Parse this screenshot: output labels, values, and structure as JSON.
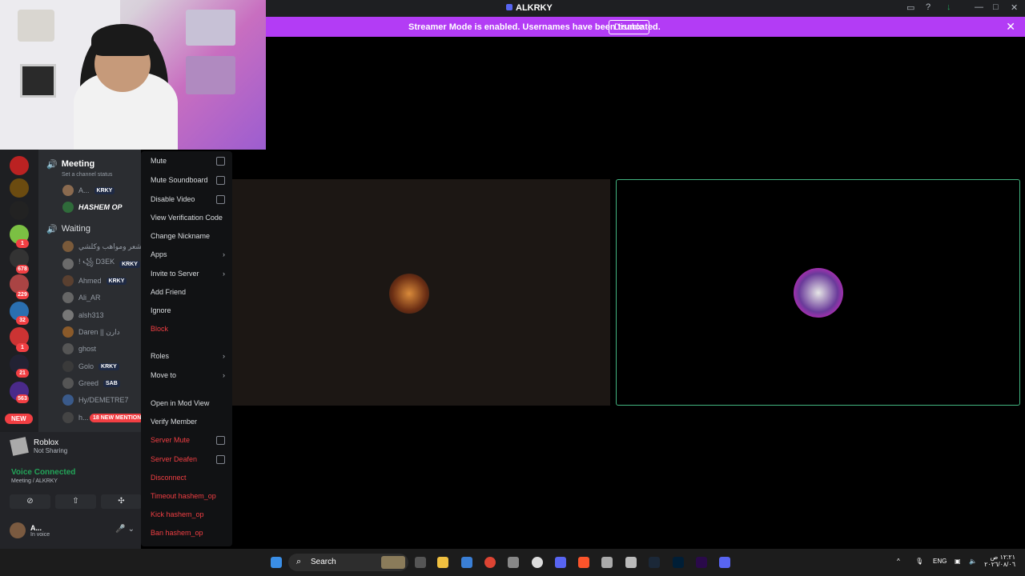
{
  "window": {
    "title": "ALKRKY"
  },
  "banner": {
    "text": "Streamer Mode is enabled. Usernames have been truncated.",
    "button": "Disable",
    "color": "#b33cf5"
  },
  "guilds": {
    "badges": [
      "1",
      "678",
      "229",
      "32",
      "1",
      "21",
      "563"
    ],
    "new_label": "NEW"
  },
  "channels": {
    "active_channel": "Meeting",
    "status_hint": "Set a channel status",
    "waiting_channel": "Waiting",
    "members_meeting": [
      {
        "name": "A...",
        "tag": "KRKY"
      },
      {
        "name": "HASHEM OP",
        "tag": ""
      }
    ],
    "members_waiting": [
      {
        "name": "و شعر ومواهب وكلشي |",
        "tag": ""
      },
      {
        "name": "! ꧁ D3EK",
        "tag": "KRKY"
      },
      {
        "name": "Ahmed",
        "tag": "KRKY"
      },
      {
        "name": "Ali_AR",
        "tag": ""
      },
      {
        "name": "alsh313",
        "tag": ""
      },
      {
        "name": "Daren || دارن",
        "tag": ""
      },
      {
        "name": "ghost",
        "tag": ""
      },
      {
        "name": "Golo",
        "tag": "KRKY"
      },
      {
        "name": "Greed",
        "tag": "SAB"
      },
      {
        "name": "Hy/DEMETRE7",
        "tag": ""
      },
      {
        "name": "h...",
        "tag": ""
      }
    ],
    "mentions_pill": "18 NEW MENTION"
  },
  "bottom": {
    "game_name": "Roblox",
    "game_status": "Not Sharing",
    "voice_title": "Voice Connected",
    "voice_sub": "Meeting / ALKRKY",
    "user_name": "A...",
    "user_status": "In voice"
  },
  "context_menu": [
    {
      "label": "Mute",
      "kind": "checkbox",
      "danger": false
    },
    {
      "label": "Mute Soundboard",
      "kind": "checkbox",
      "danger": false
    },
    {
      "label": "Disable Video",
      "kind": "checkbox",
      "danger": false
    },
    {
      "label": "View Verification Code",
      "kind": "plain",
      "danger": false
    },
    {
      "label": "Change Nickname",
      "kind": "plain",
      "danger": false
    },
    {
      "label": "Apps",
      "kind": "submenu",
      "danger": false
    },
    {
      "label": "Invite to Server",
      "kind": "submenu",
      "danger": false
    },
    {
      "label": "Add Friend",
      "kind": "plain",
      "danger": false
    },
    {
      "label": "Ignore",
      "kind": "plain",
      "danger": false
    },
    {
      "label": "Block",
      "kind": "plain",
      "danger": true
    },
    {
      "label": "Roles",
      "kind": "submenu",
      "danger": false
    },
    {
      "label": "Move to",
      "kind": "submenu",
      "danger": false
    },
    {
      "label": "Open in Mod View",
      "kind": "plain",
      "danger": false
    },
    {
      "label": "Verify Member",
      "kind": "plain",
      "danger": false
    },
    {
      "label": "Server Mute",
      "kind": "checkbox",
      "danger": true
    },
    {
      "label": "Server Deafen",
      "kind": "checkbox",
      "danger": true
    },
    {
      "label": "Disconnect",
      "kind": "plain",
      "danger": true
    },
    {
      "label": "Timeout hashem_op",
      "kind": "plain",
      "danger": true
    },
    {
      "label": "Kick hashem_op",
      "kind": "plain",
      "danger": true
    },
    {
      "label": "Ban hashem_op",
      "kind": "plain",
      "danger": true
    }
  ],
  "taskbar": {
    "search_label": "Search",
    "language": "ENG",
    "time": "١٢:٢١ ص",
    "date": "٢٠٢٦/٠٨/٠٦"
  }
}
